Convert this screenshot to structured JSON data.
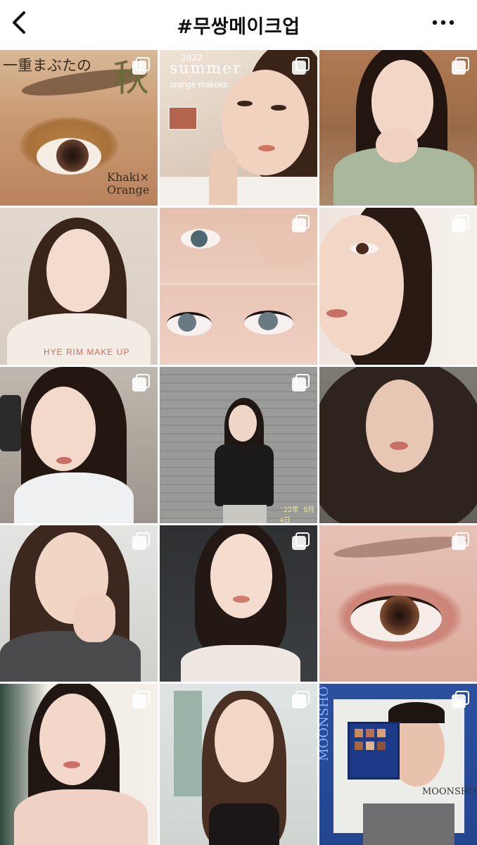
{
  "header": {
    "title": "#무쌍메이크업",
    "back_icon": "chevron-left-icon",
    "more_icon": "more-horizontal-icon"
  },
  "grid": {
    "items": [
      {
        "id": "post-1",
        "caption_top": "一重まぶたの",
        "caption_kanji": "秋",
        "caption_bottom": "Khaki×\nOrange",
        "multi": true
      },
      {
        "id": "post-2",
        "caption_year": "2022",
        "caption_title": "summer",
        "caption_sub": "orange makekp.",
        "multi": true
      },
      {
        "id": "post-3",
        "multi": true
      },
      {
        "id": "post-4",
        "caption_bottom": "HYE RIM MAKE UP",
        "multi": false
      },
      {
        "id": "post-5",
        "multi": true
      },
      {
        "id": "post-6",
        "multi": true
      },
      {
        "id": "post-7",
        "multi": true
      },
      {
        "id": "post-8",
        "caption_date": "'22年 9月4日",
        "multi": true
      },
      {
        "id": "post-9",
        "multi": false
      },
      {
        "id": "post-10",
        "multi": true
      },
      {
        "id": "post-11",
        "multi": true
      },
      {
        "id": "post-12",
        "multi": true
      },
      {
        "id": "post-13",
        "multi": true
      },
      {
        "id": "post-14",
        "multi": true
      },
      {
        "id": "post-15",
        "caption_brand": "MOONSHOT",
        "caption_side": "MOONSHOT",
        "multi": true
      }
    ]
  },
  "colors": {
    "header_bg": "#ffffff",
    "title_text": "#111111",
    "multi_icon": "#ffffff"
  }
}
